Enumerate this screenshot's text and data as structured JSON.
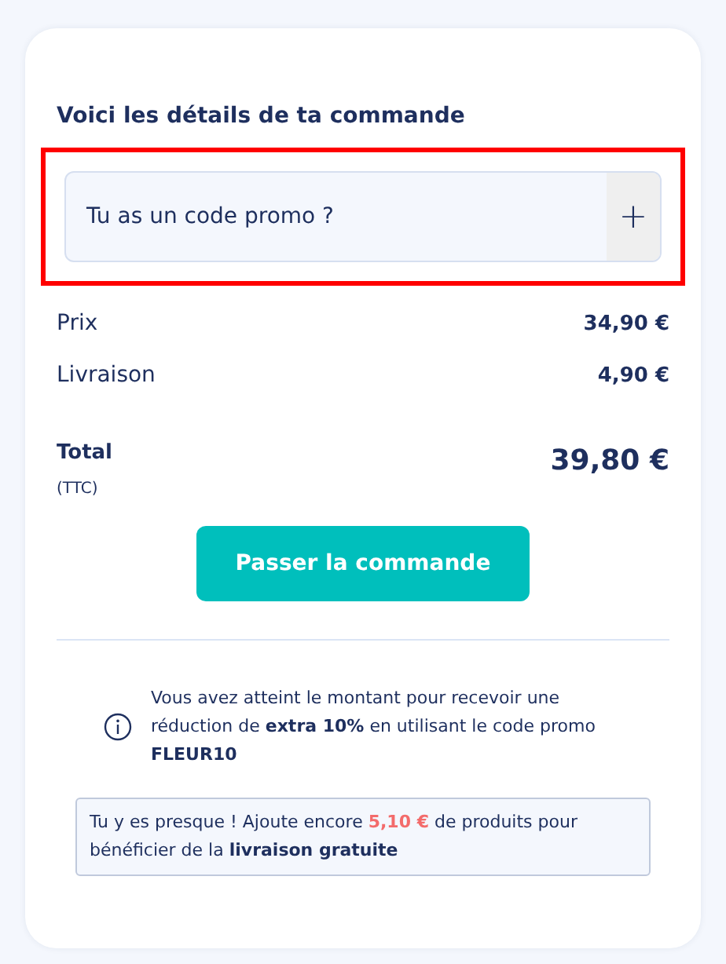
{
  "title": "Voici les détails de ta commande",
  "promo": {
    "label": "Tu as un code promo ?",
    "expand_icon": "+",
    "highlighted": true
  },
  "lines": [
    {
      "label": "Prix",
      "value": "34,90 €"
    },
    {
      "label": "Livraison",
      "value": "4,90 €"
    }
  ],
  "total": {
    "label": "Total",
    "note": "(TTC)",
    "value": "39,80 €"
  },
  "checkout_button": "Passer la commande",
  "discount_info": "Vous avez atteint le montant pour recevoir une réduction de **extra 10%** en utilisant le code promo **FLEUR10**",
  "shipping_notice": {
    "before": "Tu y es presque ! Ajoute encore",
    "amount": "5,10 €",
    "after": "de produits pour bénéficier de la **livraison gratuite**"
  }
}
